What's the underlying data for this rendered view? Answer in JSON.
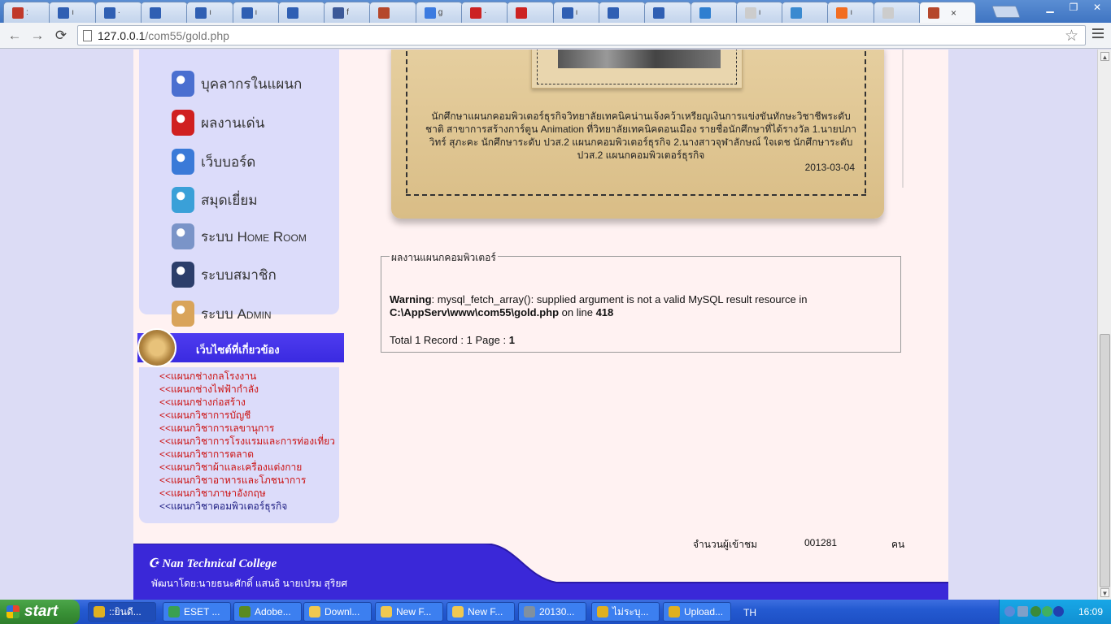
{
  "browser": {
    "tabs": [
      {
        "icon": "opera-icon",
        "color": "#c0392b",
        "label": ":"
      },
      {
        "icon": "page-icon",
        "color": "#2f5fb3",
        "label": "ı"
      },
      {
        "icon": "page-icon",
        "color": "#2f5fb3",
        "label": "·"
      },
      {
        "icon": "page-icon",
        "color": "#2f5fb3",
        "label": ""
      },
      {
        "icon": "page-icon",
        "color": "#2f5fb3",
        "label": "ı"
      },
      {
        "icon": "page-icon",
        "color": "#2f5fb3",
        "label": "ı"
      },
      {
        "icon": "page-icon",
        "color": "#2f5fb3",
        "label": ""
      },
      {
        "icon": "facebook-icon",
        "color": "#3b5998",
        "label": "f"
      },
      {
        "icon": "site-icon",
        "color": "#b5472b",
        "label": ""
      },
      {
        "icon": "google-icon",
        "color": "#3c7be0",
        "label": "g"
      },
      {
        "icon": "flag-icon",
        "color": "#c22",
        "label": "·"
      },
      {
        "icon": "news-icon",
        "color": "#cc2222",
        "label": ""
      },
      {
        "icon": "page-icon",
        "color": "#2f5fb3",
        "label": "ı"
      },
      {
        "icon": "page-icon",
        "color": "#2f5fb3",
        "label": ""
      },
      {
        "icon": "page-icon",
        "color": "#2f5fb3",
        "label": ""
      },
      {
        "icon": "chart-icon",
        "color": "#2f7fd0",
        "label": ""
      },
      {
        "icon": "doc-icon",
        "color": "#cccccc",
        "label": "ı"
      },
      {
        "icon": "search-icon",
        "color": "#3a8ad0",
        "label": ""
      },
      {
        "icon": "blogger-icon",
        "color": "#f26d21",
        "label": "ı"
      },
      {
        "icon": "doc-icon",
        "color": "#cccccc",
        "label": ""
      },
      {
        "icon": "site-icon",
        "color": "#b5472b",
        "label": ""
      }
    ],
    "close_glyph": "×",
    "url_host": "127.0.0.1",
    "url_path": "/com55/gold.php"
  },
  "sidebar": {
    "menu": [
      {
        "label": "บุคลากรในแผนก",
        "icon": "staff-icon",
        "color": "#4a6fd0"
      },
      {
        "label": "ผลงานเด่น",
        "icon": "award-ribbon-icon",
        "color": "#d02020"
      },
      {
        "label": "เว็บบอร์ด",
        "icon": "webboard-icon",
        "color": "#3a7ad8"
      },
      {
        "label": "สมุดเยี่ยม",
        "icon": "guestbook-icon",
        "color": "#3aa0d8"
      },
      {
        "label": "ระบบ Home Room",
        "icon": "homeroom-icon",
        "color": "#7a94c8"
      },
      {
        "label": "ระบบสมาชิก",
        "icon": "member-icon",
        "color": "#2c3e6a"
      },
      {
        "label": "ระบบ Admin",
        "icon": "admin-icon",
        "color": "#d9a45a"
      }
    ],
    "links_title": "เว็บไซต์ที่เกี่ยวข้อง",
    "links": [
      "<<แผนกช่างกลโรงงาน",
      "<<แผนกช่างไฟฟ้ากำลัง",
      "<<แผนกช่างก่อสร้าง",
      "<<แผนกวิชาการบัญชี",
      "<<แผนกวิชาการเลขานุการ",
      "<<แผนกวิชาการโรงแรมและการท่องเที่ยว",
      "<<แผนกวิชาการตลาด",
      "<<แผนกวิชาผ้าและเครื่องแต่งกาย",
      "<<แผนกวิชาอาหารและโภชนาการ",
      "<<แผนกวิชาภาษาอังกฤษ",
      "<<แผนกวิชาคอมพิวเตอร์ธุรกิจ"
    ]
  },
  "news": {
    "text": "นักศึกษาแผนกคอมพิวเตอร์ธุรกิจวิทยาลัยเทคนิคน่านเจ้งคว้าเหรียญเงินการแข่งขันทักษะวิชาชีพระดับชาติ สาขาการสร้างการ์ตูน Animation ที่วิทยาลัยเทคนิคดอนเมือง รายชื่อนักศึกษาที่ได้รางวัล 1.นายปภาวิทร์ สุภะคะ นักศึกษาระดับ ปวส.2 แผนกคอมพิวเตอร์ธุรกิจ 2.นางสาวจุฬาลักษณ์ ใจเดช นักศึกษาระดับ ปวส.2 แผนกคอมพิวเตอร์ธุรกิจ",
    "date": "2013-03-04"
  },
  "results": {
    "legend": "ผลงานแผนกคอมพิวเตอร์",
    "warning_label": "Warning",
    "warning_text": ": mysql_fetch_array(): supplied argument is not a valid MySQL result resource in",
    "warning_path": "C:\\AppServ\\www\\com55\\gold.php",
    "warning_on_line": " on line ",
    "warning_line": "418",
    "total_text": "Total 1 Record : 1 Page : ",
    "total_page": "1"
  },
  "counter": {
    "label": "จำนวนผู้เข้าชม",
    "value": "001281",
    "unit": "คน"
  },
  "footer": {
    "title": "Nan Technical College",
    "credit": "พัฒนาโดย:นายธนะศักดิ์ แสนธิ นายเปรม สุริยศ",
    "bar_color": "#3a28d8"
  },
  "taskbar": {
    "start_label": "start",
    "items": [
      {
        "label": "::ยินดี...",
        "icon": "chrome-icon",
        "color": "#e0b020",
        "active": true
      },
      {
        "label": "ESET ...",
        "icon": "eset-icon",
        "color": "#3aa050",
        "active": false
      },
      {
        "label": "Adobe...",
        "icon": "dreamweaver-icon",
        "color": "#5a8a20",
        "active": false
      },
      {
        "label": "Downl...",
        "icon": "folder-icon",
        "color": "#f0c850",
        "active": false
      },
      {
        "label": "New F...",
        "icon": "folder-icon",
        "color": "#f0c850",
        "active": false
      },
      {
        "label": "New F...",
        "icon": "folder-icon",
        "color": "#f0c850",
        "active": false
      },
      {
        "label": "20130...",
        "icon": "image-viewer-icon",
        "color": "#8090a0",
        "active": false
      },
      {
        "label": "ไม่ระบุ...",
        "icon": "chrome-icon",
        "color": "#e0b020",
        "active": false
      },
      {
        "label": "Upload...",
        "icon": "chrome-icon",
        "color": "#e0b020",
        "active": false
      }
    ],
    "language": "TH",
    "clock": "16:09"
  }
}
